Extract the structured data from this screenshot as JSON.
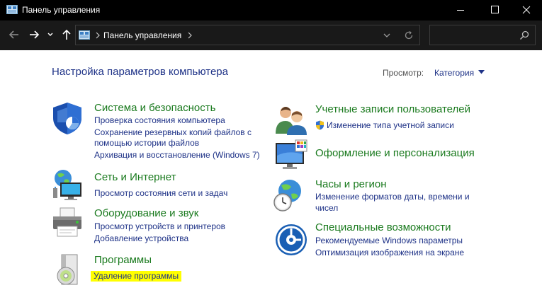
{
  "window": {
    "title": "Панель управления"
  },
  "address": {
    "crumb": "Панель управления",
    "search_placeholder": ""
  },
  "header": {
    "title": "Настройка параметров компьютера",
    "view_label": "Просмотр:",
    "view_value": "Категория"
  },
  "left": {
    "system": {
      "title": "Система и безопасность",
      "links": [
        "Проверка состояния компьютера",
        "Сохранение резервных копий файлов с",
        "помощью истории файлов",
        "Архивация и восстановление (Windows 7)"
      ]
    },
    "network": {
      "title": "Сеть и Интернет",
      "links": [
        "Просмотр состояния сети и задач"
      ]
    },
    "hardware": {
      "title": "Оборудование и звук",
      "links": [
        "Просмотр устройств и принтеров",
        "Добавление устройства"
      ]
    },
    "programs": {
      "title": "Программы",
      "links": [
        "Удаление программы"
      ]
    }
  },
  "right": {
    "accounts": {
      "title": "Учетные записи пользователей",
      "links": [
        "Изменение типа учетной записи"
      ]
    },
    "appearance": {
      "title": "Оформление и персонализация"
    },
    "clock": {
      "title": "Часы и регион",
      "links": [
        "Изменение форматов даты, времени и",
        "чисел"
      ]
    },
    "access": {
      "title": "Специальные возможности",
      "links": [
        "Рекомендуемые Windows параметры",
        "Оптимизация изображения на экране"
      ]
    },
    "highlight_color": "#ffff00"
  },
  "colors": {
    "link": "#1e3287",
    "category": "#1a7a1e",
    "titlebar": "#000000"
  }
}
